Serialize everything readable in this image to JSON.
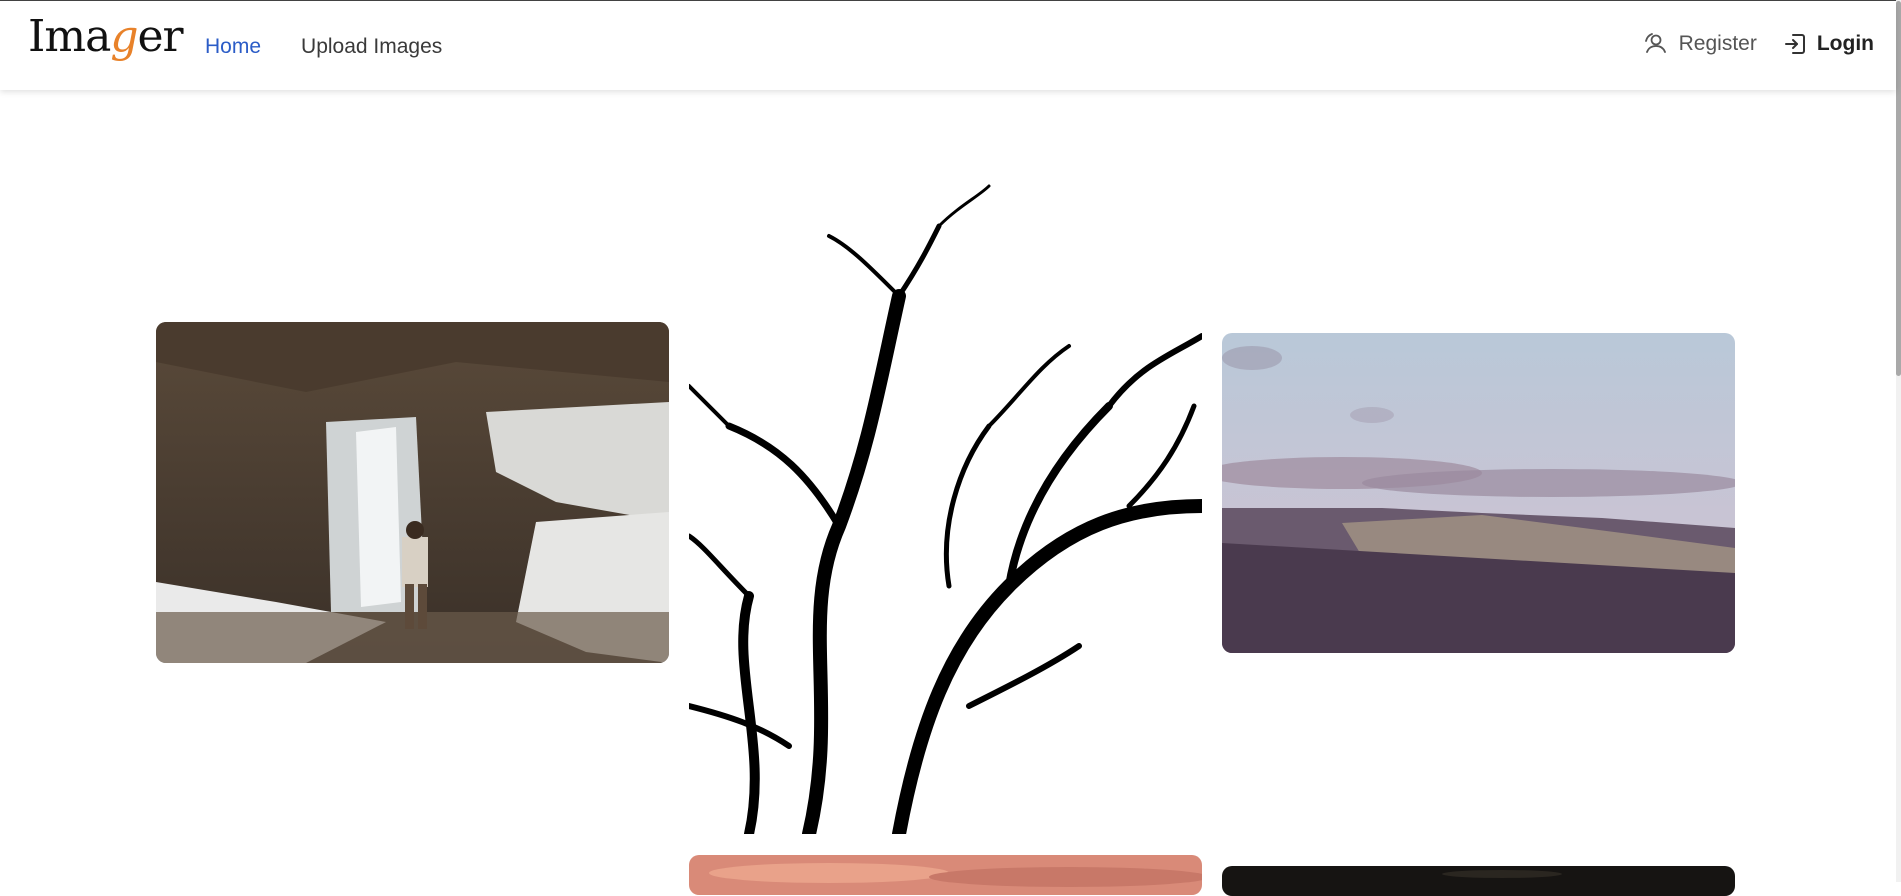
{
  "brand": {
    "name_prefix": "Ima",
    "name_accent": "g",
    "name_suffix": "er"
  },
  "nav": {
    "home": "Home",
    "upload": "Upload Images"
  },
  "auth": {
    "register": "Register",
    "login": "Login"
  },
  "colors": {
    "accent": "#2b5cc7",
    "brand_accent": "#e8822a"
  },
  "gallery": {
    "items": [
      {
        "id": "waterfall",
        "subject": "snowy waterfall with person standing"
      },
      {
        "id": "tree",
        "subject": "black tree branch silhouette"
      },
      {
        "id": "forest",
        "subject": "snowy forest hills at sunset"
      },
      {
        "id": "pink-sky",
        "subject": "pink clouds"
      },
      {
        "id": "dark",
        "subject": "dark image"
      }
    ]
  }
}
